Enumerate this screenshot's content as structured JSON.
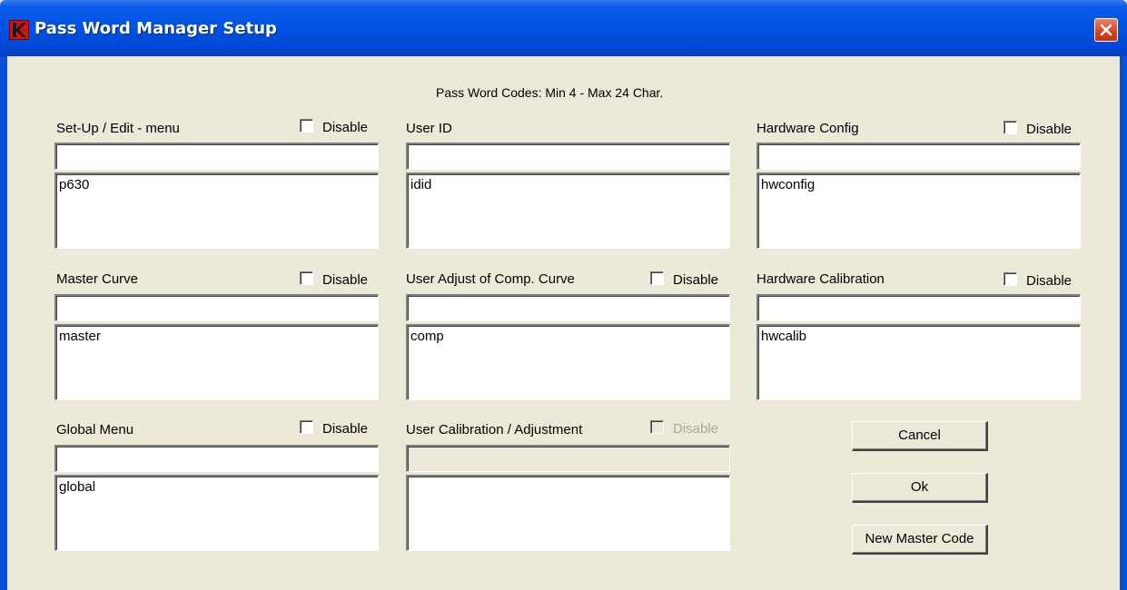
{
  "window": {
    "title": "Pass Word Manager Setup"
  },
  "hint": "Pass Word Codes:  Min 4  - Max 24 Char.",
  "disable_label": "Disable",
  "sections": [
    {
      "label": "Set-Up / Edit - menu",
      "disable_checked": false,
      "disable_enabled": true,
      "code_input": "",
      "code_list": "p630"
    },
    {
      "label": "User ID",
      "code_input": "",
      "code_list": "idid"
    },
    {
      "label": "Hardware Config",
      "disable_checked": false,
      "disable_enabled": true,
      "code_input": "",
      "code_list": "hwconfig"
    },
    {
      "label": "Master Curve",
      "disable_checked": false,
      "disable_enabled": true,
      "code_input": "",
      "code_list": "master"
    },
    {
      "label": "User Adjust of Comp. Curve",
      "disable_checked": false,
      "disable_enabled": true,
      "code_input": "",
      "code_list": "comp"
    },
    {
      "label": "Hardware Calibration",
      "disable_checked": false,
      "disable_enabled": true,
      "code_input": "",
      "code_list": "hwcalib"
    },
    {
      "label": "Global Menu",
      "disable_checked": false,
      "disable_enabled": true,
      "code_input": "",
      "code_list": "global"
    },
    {
      "label": "User Calibration / Adjustment",
      "disable_checked": false,
      "disable_enabled": false,
      "code_input": "",
      "code_list": ""
    }
  ],
  "buttons": {
    "cancel": "Cancel",
    "ok": "Ok",
    "new_master_code": "New Master Code"
  },
  "colors": {
    "titlebar": "#0053e3",
    "dialog_bg": "#ece9d8",
    "close_button": "#d5431a",
    "app_icon": "#cc1414"
  }
}
